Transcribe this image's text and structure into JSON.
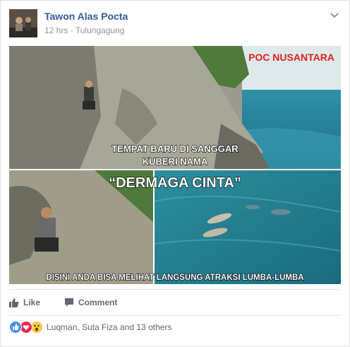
{
  "post": {
    "author": "Tawon Alas Pocta",
    "time": "12 hrs",
    "separator": " · ",
    "location": "Tulungagung"
  },
  "image": {
    "badge": "POC NUSANTARA",
    "caption_line1": "TEMPAT BARU DI SANGGAR",
    "caption_line2": "KUBERI NAMA",
    "caption_title": "“DERMAGA CINTA”",
    "bottom_caption": "DISINI ANDA BISA MELIHAT LANGSUNG ATRAKSI LUMBA-LUMBA"
  },
  "actions": {
    "like_label": "Like",
    "comment_label": "Comment"
  },
  "reactions": {
    "summary": "Luqman, Suta Fiza and 13 others",
    "types": [
      "like-icon",
      "love-icon",
      "wow-icon"
    ],
    "colors": {
      "like": "#4a8cf7",
      "love": "#f0284a",
      "wow": "#f7c948"
    }
  },
  "colors": {
    "link": "#365899",
    "meta": "#90949c",
    "action": "#606770"
  }
}
